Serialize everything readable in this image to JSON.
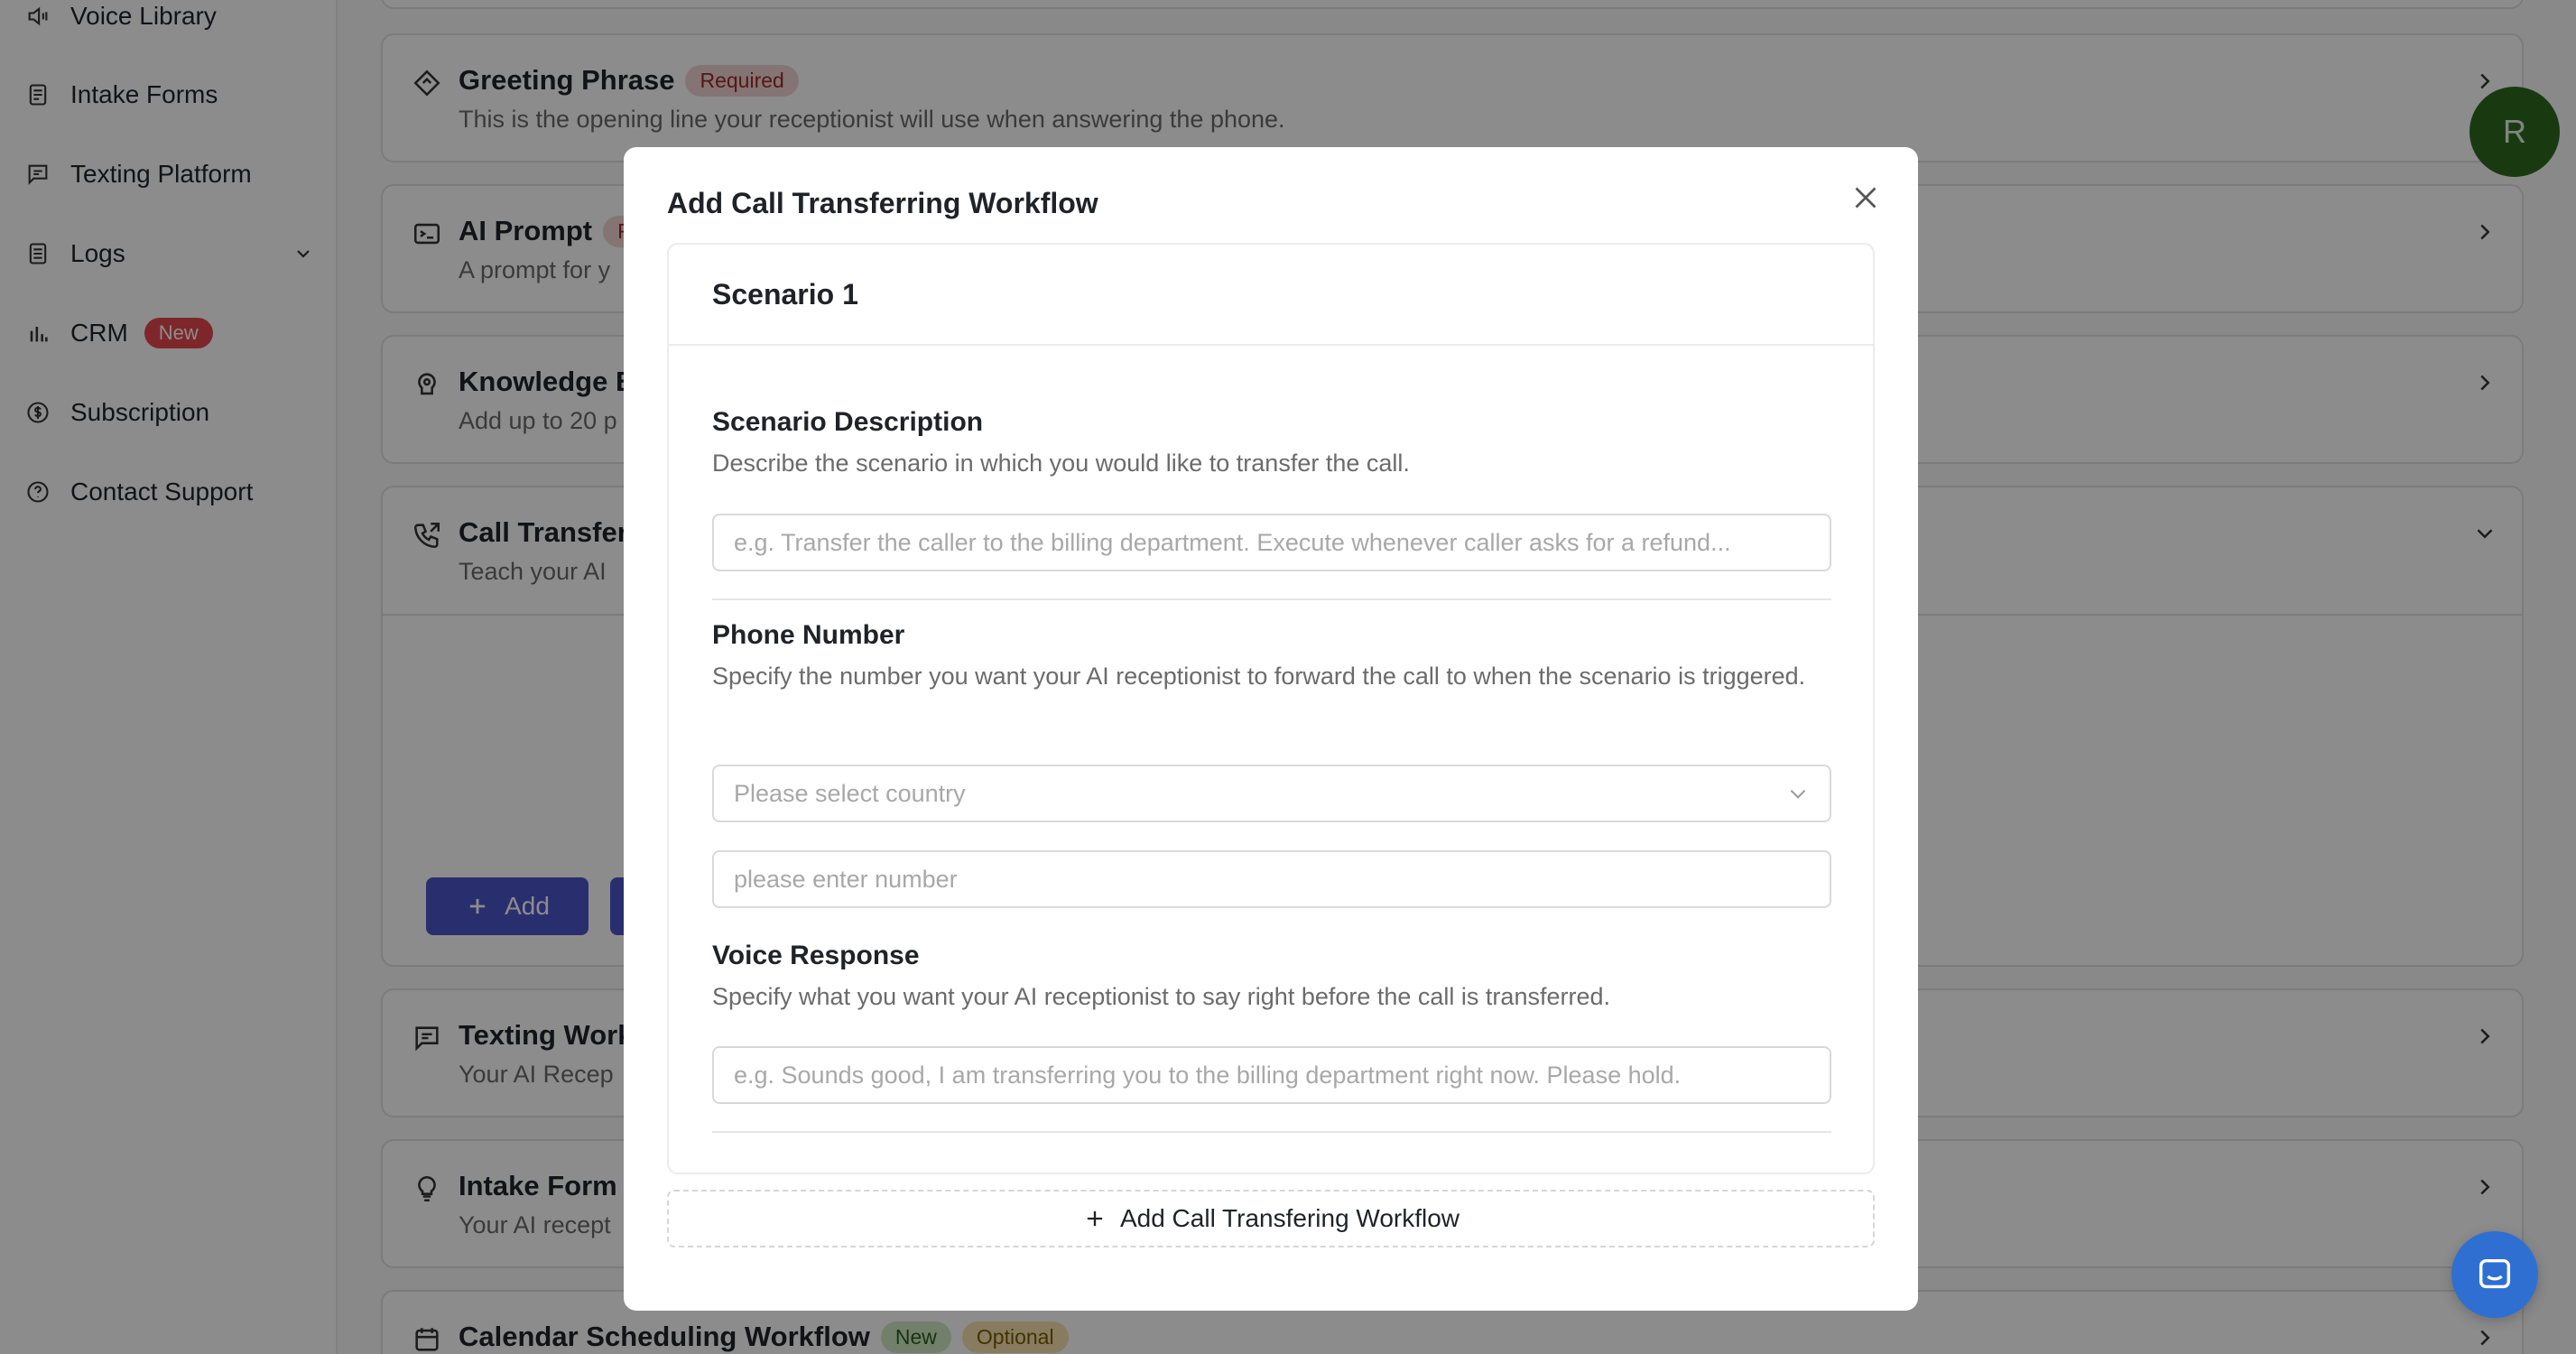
{
  "sidebar": {
    "items": [
      {
        "label": "Voice Library",
        "icon": "speaker-icon"
      },
      {
        "label": "Intake Forms",
        "icon": "document-icon"
      },
      {
        "label": "Texting Platform",
        "icon": "message-icon"
      },
      {
        "label": "Logs",
        "icon": "list-icon"
      },
      {
        "label": "CRM",
        "icon": "bar-chart-icon",
        "badge": "New"
      },
      {
        "label": "Subscription",
        "icon": "dollar-icon"
      },
      {
        "label": "Contact Support",
        "icon": "help-icon"
      }
    ]
  },
  "cards": {
    "greeting": {
      "title": "Greeting Phrase",
      "badge": "Required",
      "subtitle": "This is the opening line your receptionist will use when answering the phone."
    },
    "ai_prompt": {
      "title": "AI Prompt",
      "badge_partial": "R",
      "subtitle": "A prompt for y"
    },
    "knowledge": {
      "title": "Knowledge B",
      "subtitle": "Add up to 20 p"
    },
    "call_transfer": {
      "title": "Call Transfer",
      "subtitle": "Teach your AI",
      "add_label": "Add"
    },
    "texting": {
      "title": "Texting Work",
      "subtitle": "Your AI Recep"
    },
    "intake": {
      "title": "Intake Form",
      "subtitle": "Your AI recept"
    },
    "calendar": {
      "title": "Calendar Scheduling Workflow",
      "badge_new": "New",
      "badge_optional": "Optional"
    }
  },
  "avatar": {
    "initial": "R"
  },
  "modal": {
    "title": "Add Call Transferring Workflow",
    "scenario_title": "Scenario 1",
    "scenario_description": {
      "label": "Scenario Description",
      "help": "Describe the scenario in which you would like to transfer the call.",
      "placeholder": "e.g. Transfer the caller to the billing department. Execute whenever caller asks for a refund...",
      "value": ""
    },
    "phone_number": {
      "label": "Phone Number",
      "help": "Specify the number you want your AI receptionist to forward the call to when the scenario is triggered.",
      "country_placeholder": "Please select country",
      "number_placeholder": "please enter number",
      "value": ""
    },
    "voice_response": {
      "label": "Voice Response",
      "help": "Specify what you want your AI receptionist to say right before the call is transferred.",
      "placeholder": "e.g. Sounds good, I am transferring you to the billing department right now. Please hold.",
      "value": ""
    },
    "add_workflow_label": "Add Call Transfering Workflow"
  },
  "colors": {
    "accent": "#4b55c8",
    "avatar_bg": "#2e6b1f",
    "chat_bubble": "#2f6fd1",
    "badge_red": "#e5484d"
  }
}
